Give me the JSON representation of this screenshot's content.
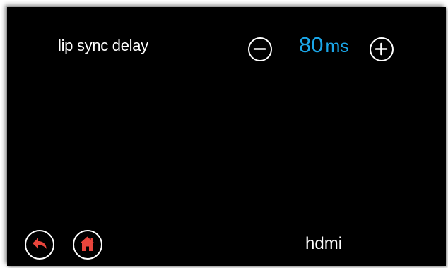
{
  "setting": {
    "label": "lip sync delay",
    "value": "80",
    "unit": "ms",
    "decrease_icon": "minus-circle-icon",
    "increase_icon": "plus-circle-icon"
  },
  "footer": {
    "back_icon": "back-arrow-icon",
    "home_icon": "home-icon",
    "source": "hdmi"
  },
  "colors": {
    "background": "#000000",
    "value": "#1aa6e8",
    "icon_accent": "#e8453c",
    "text": "#ffffff"
  }
}
